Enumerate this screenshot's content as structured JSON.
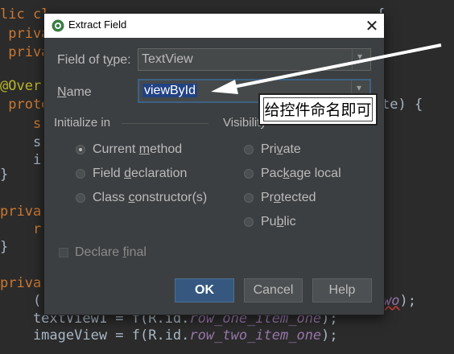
{
  "editor": {
    "lines": [
      {
        "pre": "lic cl",
        "kw": "",
        "rest": "                        ",
        "tail": "{"
      },
      {
        "text": " priva"
      },
      {
        "text": " priva"
      },
      {
        "text": ""
      },
      {
        "text": "@Overr"
      },
      {
        "text": " prote",
        "tail": "te) {"
      },
      {
        "text": "    s"
      },
      {
        "text": "    s"
      },
      {
        "text": "    i"
      },
      {
        "text": "}"
      },
      {
        "text": ""
      },
      {
        "text": "priva"
      },
      {
        "text": "    r"
      },
      {
        "text": "}"
      },
      {
        "text": ""
      },
      {
        "text": "priva"
      },
      {
        "text": "    ("
      },
      {
        "text": "    textView1 = f(R.id.row_one_item_one);"
      },
      {
        "text": "    imageView = f(R.id.row_two_item_one);"
      }
    ],
    "line18_a": "    textView1 = f(R.id.",
    "line18_b": "row_one_item_one",
    "line18_c": ");",
    "line19_a": "    imageView = f(R.id.",
    "line19_b": "row_two_item_one",
    "line19_c": ");",
    "overflow_text": "wo",
    "overflow_tail": ");"
  },
  "dialog": {
    "title": "Extract Field",
    "close_glyph": "✕",
    "field_of_type_label_pre": "Field of t",
    "field_of_type_label_u": "y",
    "field_of_type_label_post": "pe:",
    "field_of_type_value": "TextView",
    "name_label_u": "N",
    "name_label_post": "ame",
    "name_value": "viewById",
    "initialize_in_label": "Initialize in",
    "visibility_label": "Visibility",
    "init_options": [
      {
        "pre": "Current ",
        "u": "m",
        "post": "ethod",
        "selected": true
      },
      {
        "pre": "Field ",
        "u": "d",
        "post": "eclaration",
        "selected": false
      },
      {
        "pre": "Class ",
        "u": "c",
        "post": "onstructor(s)",
        "selected": false
      }
    ],
    "visibility_options": [
      {
        "pre": "Pri",
        "u": "v",
        "post": "ate",
        "selected": false
      },
      {
        "pre": "Pac",
        "u": "k",
        "post": "age local",
        "selected": false
      },
      {
        "pre": "Pr",
        "u": "o",
        "post": "tected",
        "selected": false
      },
      {
        "pre": "Pu",
        "u": "b",
        "post": "lic",
        "selected": false
      }
    ],
    "declare_final_pre": "Declare ",
    "declare_final_u": "f",
    "declare_final_post": "inal",
    "buttons": {
      "ok": "OK",
      "cancel": "Cancel",
      "help": "Help"
    }
  },
  "annotation": {
    "callout_text": "给控件命名即可"
  },
  "colors": {
    "editor_bg": "#2b2b2b",
    "dialog_bg": "#3c3f41",
    "ok_button": "#365880",
    "selection": "#214283"
  }
}
